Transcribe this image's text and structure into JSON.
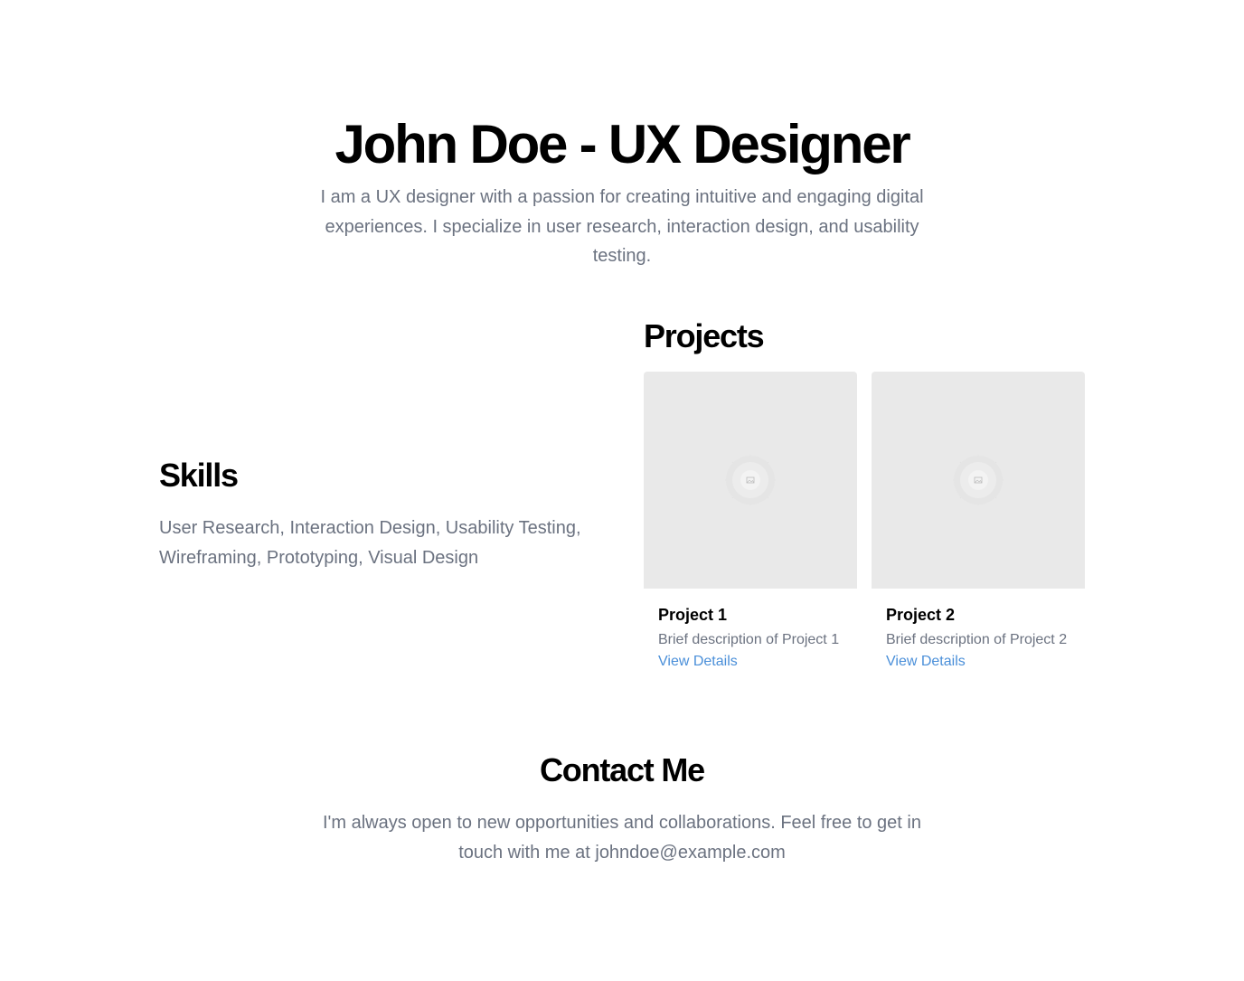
{
  "hero": {
    "title": "John Doe - UX Designer",
    "intro": "I am a UX designer with a passion for creating intuitive and engaging digital experiences. I specialize in user research, interaction design, and usability testing."
  },
  "skills": {
    "heading": "Skills",
    "text": "User Research, Interaction Design, Usability Testing, Wireframing, Prototyping, Visual Design"
  },
  "projects": {
    "heading": "Projects",
    "items": [
      {
        "title": "Project 1",
        "description": "Brief description of Project 1",
        "link": "View Details",
        "image_icon": "image-placeholder-icon"
      },
      {
        "title": "Project 2",
        "description": "Brief description of Project 2",
        "link": "View Details",
        "image_icon": "image-placeholder-icon"
      }
    ]
  },
  "contact": {
    "heading": "Contact Me",
    "text": "I'm always open to new opportunities and collaborations. Feel free to get in touch with me at johndoe@example.com"
  },
  "colors": {
    "text": "#000000",
    "muted": "#6b7280",
    "link": "#4a8fd9",
    "placeholder_bg": "#e9e9e9"
  }
}
